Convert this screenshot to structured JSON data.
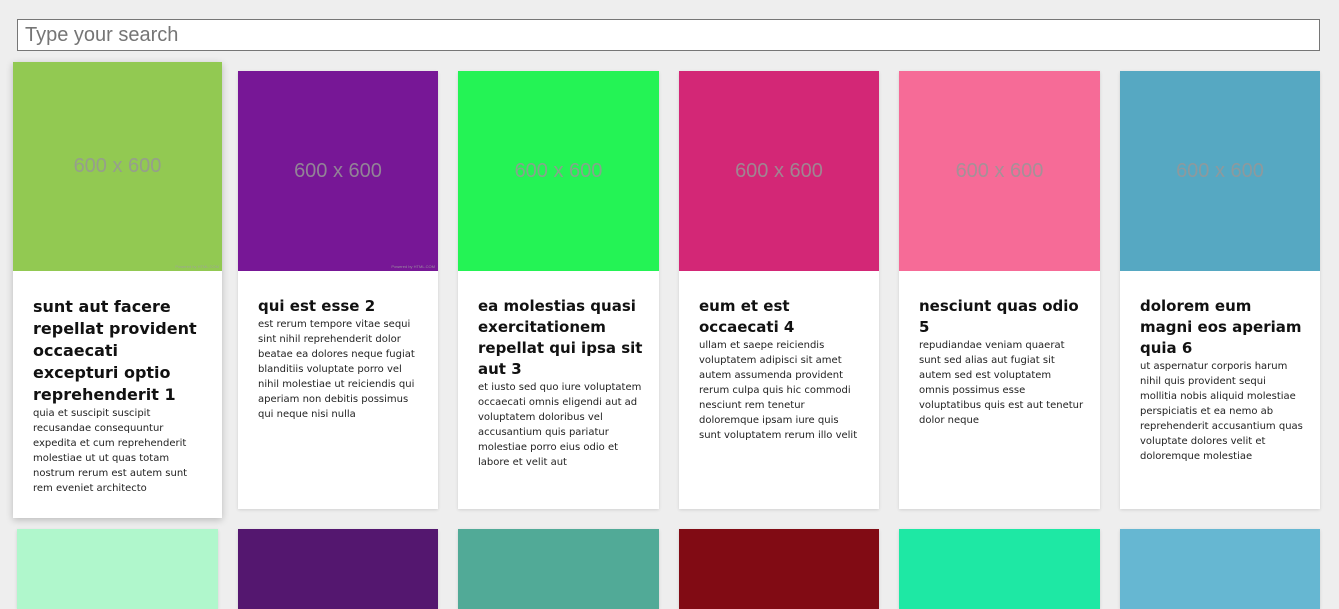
{
  "search": {
    "placeholder": "Type your search",
    "value": ""
  },
  "cards": [
    {
      "image_label": "600 x 600",
      "image_color": "#92c952",
      "image_credit": "Powered by HTML.COM",
      "title": "sunt aut facere repellat provident occaecati excepturi optio reprehenderit 1",
      "body": "quia et suscipit suscipit recusandae consequuntur expedita et cum reprehenderit molestiae ut ut quas totam nostrum rerum est autem sunt rem eveniet architecto"
    },
    {
      "image_label": "600 x 600",
      "image_color": "#771796",
      "image_credit": "Powered by HTML.COM",
      "title": "qui est esse 2",
      "body": "est rerum tempore vitae sequi sint nihil reprehenderit dolor beatae ea dolores neque fugiat blanditiis voluptate porro vel nihil molestiae ut reiciendis qui aperiam non debitis possimus qui neque nisi nulla"
    },
    {
      "image_label": "600 x 600",
      "image_color": "#24f355",
      "title": "ea molestias quasi exercitationem repellat qui ipsa sit aut 3",
      "body": "et iusto sed quo iure voluptatem occaecati omnis eligendi aut ad voluptatem doloribus vel accusantium quis pariatur molestiae porro eius odio et labore et velit aut"
    },
    {
      "image_label": "600 x 600",
      "image_color": "#d32776",
      "title": "eum et est occaecati 4",
      "body": "ullam et saepe reiciendis voluptatem adipisci sit amet autem assumenda provident rerum culpa quis hic commodi nesciunt rem tenetur doloremque ipsam iure quis sunt voluptatem rerum illo velit"
    },
    {
      "image_label": "600 x 600",
      "image_color": "#f66b97",
      "title": "nesciunt quas odio 5",
      "body": "repudiandae veniam quaerat sunt sed alias aut fugiat sit autem sed est voluptatem omnis possimus esse voluptatibus quis est aut tenetur dolor neque"
    },
    {
      "image_label": "600 x 600",
      "image_color": "#56a8c2",
      "title": "dolorem eum magni eos aperiam quia 6",
      "body": "ut aspernatur corporis harum nihil quis provident sequi mollitia nobis aliquid molestiae perspiciatis et ea nemo ab reprehenderit accusantium quas voluptate dolores velit et doloremque molestiae"
    },
    {
      "image_color": "#b0f7cc"
    },
    {
      "image_color": "#54176f"
    },
    {
      "image_color": "#51aa97"
    },
    {
      "image_color": "#810b14"
    },
    {
      "image_color": "#1ee8a4"
    },
    {
      "image_color": "#66b7d2"
    }
  ]
}
